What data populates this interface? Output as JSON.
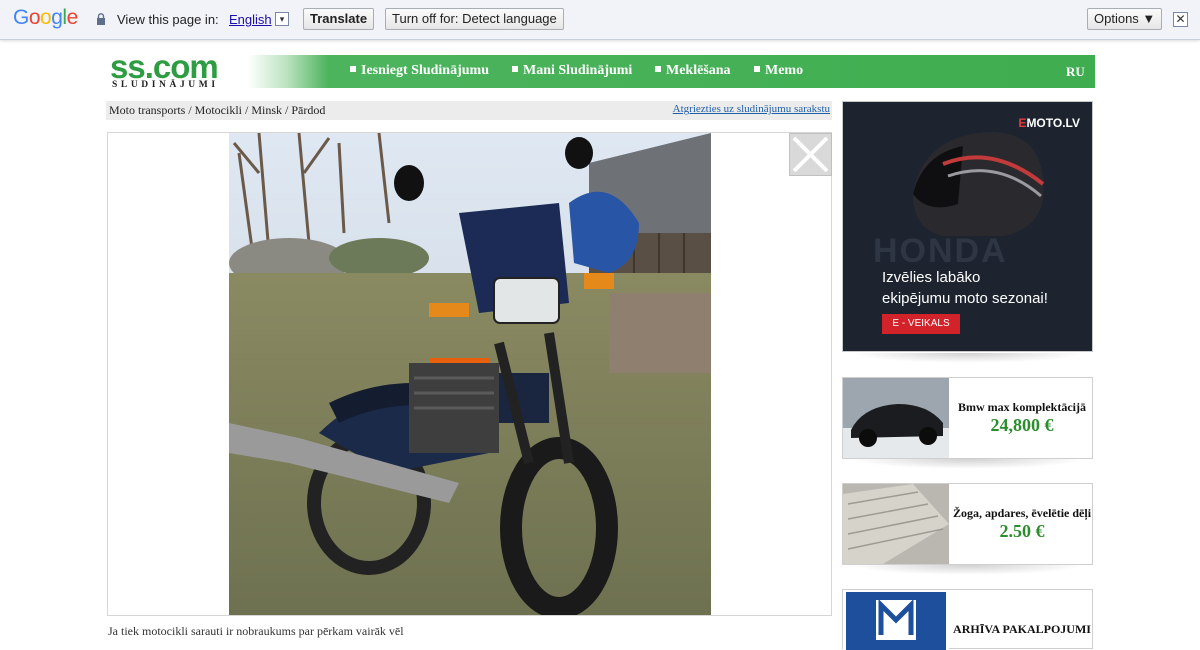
{
  "translate_bar": {
    "logo": "Google",
    "view_label": "View this page in:",
    "language": "English",
    "language_arrow": "▾",
    "translate_label": "Translate",
    "turn_off_label": "Turn off for: Detect language",
    "options_label": "Options ▼",
    "close_label": "✕"
  },
  "site": {
    "logo_main": "ss.com",
    "logo_sub": "SLUDINĀJUMI",
    "nav": [
      "Iesniegt Sludinājumu",
      "Mani Sludinājumi",
      "Meklēšana",
      "Memo"
    ],
    "lang_switch": "RU"
  },
  "breadcrumb": {
    "path": "Moto transports / Motocikli / Minsk / Pārdod",
    "back_link": "Atgriezties uz sludinājumu sarakstu"
  },
  "listing": {
    "description_start": "Ja tiek motocikli sarauti ir nobraukums par pērkam vairāk vēl"
  },
  "sidebar": {
    "banner": {
      "brand_e": "E",
      "brand_rest": "MOTO.LV",
      "bg_word": "HONDA",
      "tagline_1": "Izvēlies labāko",
      "tagline_2": "ekipējumu moto sezonai!",
      "button": "E - VEIKALS"
    },
    "cards": [
      {
        "title": "Bmw max komplektācijā",
        "price": "24,800 €"
      },
      {
        "title": "Žoga, apdares, ēvelētie dēļi",
        "price": "2.50 €"
      },
      {
        "title": "ARHĪVA PAKALPOJUMI",
        "price": ""
      }
    ]
  },
  "colors": {
    "ss_green": "#3fad4f",
    "price_green": "#2b8d2b",
    "link_blue": "#1f5fa8"
  }
}
